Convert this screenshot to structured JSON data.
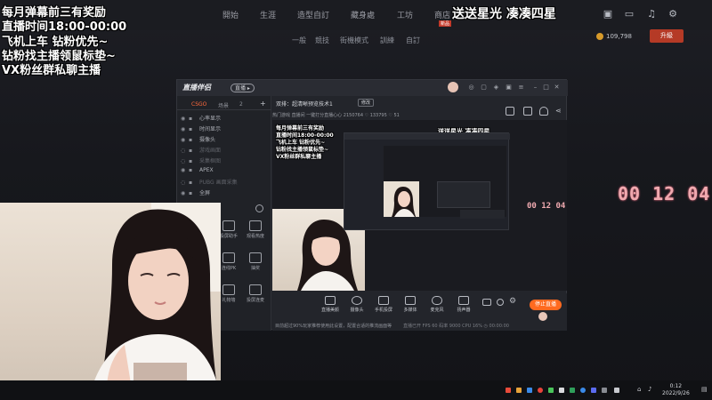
{
  "overlay": {
    "line1": "每月弹幕前三有奖励",
    "line2": "直播时间18:00-00:00",
    "line3": "飞机上车 钻粉优先~",
    "line4": "钻粉找主播领鼠标垫~",
    "line5": "VX粉丝群私聊主播",
    "top_right": "送送星光 凑凑四星"
  },
  "game_nav": {
    "items": [
      "開始",
      "生涯",
      "造型自訂",
      "藏身處",
      "工坊",
      "商店"
    ],
    "subnav": [
      "一般",
      "競技",
      "街機模式",
      "訓練",
      "自訂"
    ],
    "shop_badge": "新品",
    "currency": "109,798",
    "upgrade_label": "升級"
  },
  "clock": {
    "text": "00 12 04"
  },
  "obs": {
    "logo": "直播伴侣",
    "version_badge": "直播 ▸",
    "tabs": [
      "CSGO",
      "场景",
      "2"
    ],
    "sources": [
      {
        "label": "心率显示",
        "dim": false
      },
      {
        "label": "时间显示",
        "dim": false
      },
      {
        "label": "摄像头",
        "dim": false
      },
      {
        "label": "游戏画面",
        "dim": true
      },
      {
        "label": "采集框图",
        "dim": true
      },
      {
        "label": "APEX",
        "dim": false
      },
      {
        "label": "PUBG 画面采集",
        "dim": true
      },
      {
        "label": "全屏",
        "dim": false
      }
    ],
    "tools": [
      "投屏助手",
      "观看热度",
      "连线PK",
      "抽奖",
      "礼物墙",
      "投屏连麦"
    ],
    "header_title": "双排：超清晰预览技术1",
    "header_btn": "修改",
    "header_line2": "热门游戏   直播间   一键打分直播心心   2150764   ♡ 133795   ♡ 51",
    "bottom_buttons": [
      "直播美颜",
      "摄像头",
      "手机投屏",
      "多媒体",
      "麦克风",
      "扬声器"
    ],
    "go_live": "停止直播",
    "footnote": "目前超过90%玩家推荐使用此设置，配置合适的推流画面等",
    "status_right": "直播已开   FPS 60   码率 9000   CPU 16%   ◷ 00:00:00"
  },
  "nested": {
    "overlay": "送送星光 凑凑四星",
    "clock": "00 12 04"
  },
  "taskbar": {
    "time": "0:12",
    "date": "2022/9/26"
  }
}
